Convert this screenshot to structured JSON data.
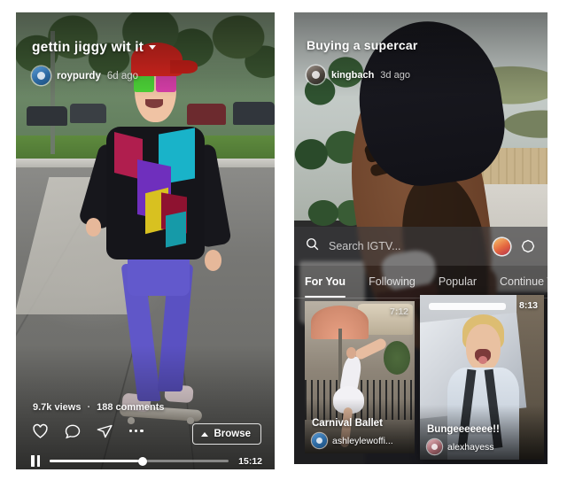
{
  "left_phone": {
    "video": {
      "title": "gettin jiggy wit it",
      "username": "roypurdy",
      "time_ago": "6d ago",
      "views": "9.7k views",
      "separator": "·",
      "comments": "188 comments"
    },
    "actions": {
      "like": "like-icon",
      "comment": "comment-icon",
      "share": "share-icon",
      "more": "more-options-icon",
      "browse_label": "Browse"
    },
    "player": {
      "state_icon": "pause-icon",
      "progress_percent": 52,
      "time_remaining": "15:12"
    }
  },
  "right_phone": {
    "video": {
      "title": "Buying a supercar",
      "username": "kingbach",
      "time_ago": "3d ago"
    },
    "igtv": {
      "search_placeholder": "Search IGTV...",
      "search_value": "",
      "story_icon": "story-avatar-icon",
      "camera_icon": "igtv-camera-icon",
      "tabs": [
        {
          "label": "For You",
          "active": true
        },
        {
          "label": "Following",
          "active": false
        },
        {
          "label": "Popular",
          "active": false
        },
        {
          "label": "Continue W",
          "active": false
        }
      ],
      "cards": [
        {
          "title": "Carnival Ballet",
          "username": "ashleylewoffi...",
          "duration": "7:12"
        },
        {
          "title": "Bungeeeeeee!!",
          "username": "alexhayess",
          "duration": "8:13"
        }
      ]
    }
  },
  "colors": {
    "page_background": "#ffffff",
    "overlay_text": "#ffffff",
    "accent_tab_underline": "#ffffff",
    "sheet_background": "rgba(22,22,26,0.62)"
  }
}
